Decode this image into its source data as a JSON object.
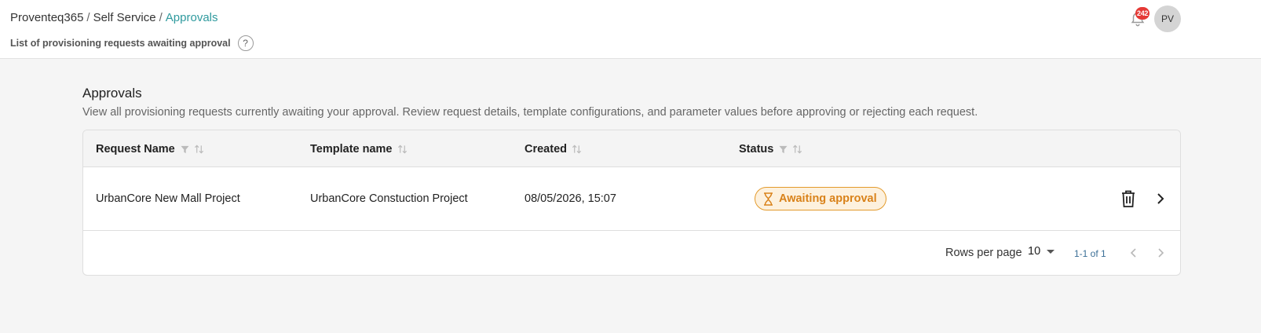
{
  "header": {
    "breadcrumb": [
      "Proventeq365",
      "Self Service",
      "Approvals"
    ],
    "subtitle": "List of provisioning requests awaiting approval",
    "help_glyph": "?",
    "notification_count": "242",
    "avatar_initials": "PV",
    "icons": {
      "help": "question-circle-icon",
      "notifications": "bell-icon"
    }
  },
  "section": {
    "title": "Approvals",
    "description": "View all provisioning requests currently awaiting your approval. Review request details, template configurations, and parameter values before approving or rejecting each request."
  },
  "table": {
    "columns": [
      {
        "label": "Request Name",
        "filter": true,
        "sort": true
      },
      {
        "label": "Template name",
        "filter": false,
        "sort": true
      },
      {
        "label": "Created",
        "filter": false,
        "sort": true
      },
      {
        "label": "Status",
        "filter": true,
        "sort": true
      }
    ],
    "rows": [
      {
        "request_name": "UrbanCore New Mall Project",
        "template_name": "UrbanCore Constuction Project",
        "created": "08/05/2026, 15:07",
        "status": "Awaiting approval",
        "status_icon": "hourglass-icon",
        "actions": [
          "delete-icon",
          "chevron-right-icon"
        ]
      }
    ],
    "pagination": {
      "rows_per_page_label": "Rows per page",
      "rows_per_page_value": "10",
      "range": "1-1 of 1"
    }
  },
  "colors": {
    "accent": "#2f9a9e",
    "status_text": "#d9821a",
    "status_border": "#e39a2b",
    "status_bg": "#fdf1de",
    "badge": "#e53935"
  }
}
